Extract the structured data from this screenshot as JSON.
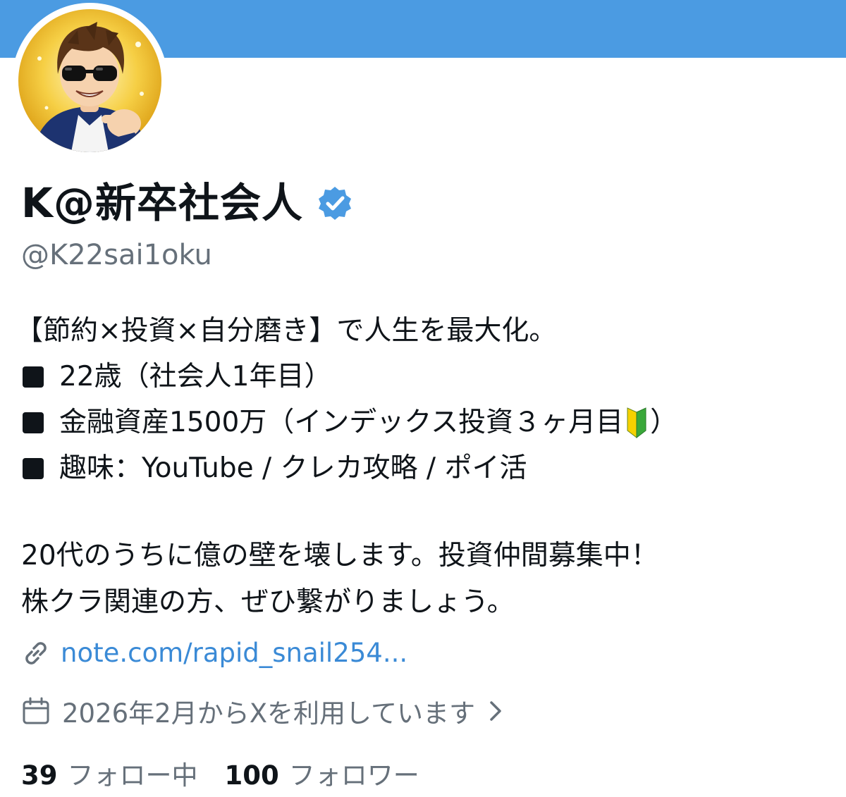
{
  "profile": {
    "display_name": "K@新卒社会人",
    "verified_icon": "verified-badge-icon",
    "handle": "@K22sai1oku",
    "accent_color": "#4b9be2",
    "avatar_icon": "avatar-sunglasses-man-icon"
  },
  "bio": {
    "line1": "【節約×投資×自分磨き】で人生を最大化。",
    "line2": "22歳（社会人1年目）",
    "line3_before": "金融資産1500万（インデックス投資３ヶ月目",
    "line3_icon": "beginner-mark-icon",
    "line3_after": "）",
    "line4": "趣味：YouTube / クレカ攻略 / ポイ活",
    "line5": "20代のうちに億の壁を壊します。投資仲間募集中！",
    "line6": "株クラ関連の方、ぜひ繋がりましょう。"
  },
  "link": {
    "icon": "link-icon",
    "text": "note.com/rapid_snail254..."
  },
  "joined": {
    "icon": "calendar-icon",
    "text": "2026年2月からXを利用しています",
    "chevron_icon": "chevron-right-icon"
  },
  "stats": {
    "following_count": "39",
    "following_label": "フォロー中",
    "followers_count": "100",
    "followers_label": "フォロワー"
  }
}
